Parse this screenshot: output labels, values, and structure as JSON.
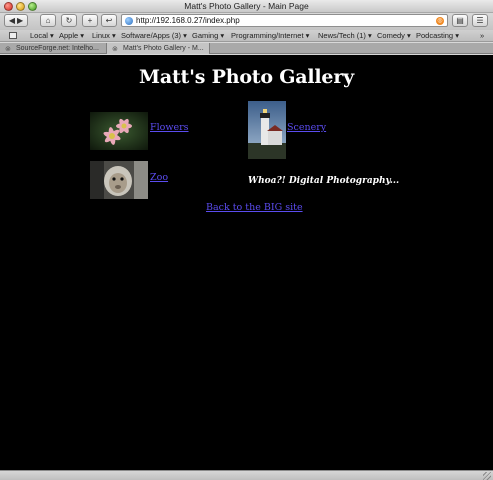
{
  "window": {
    "title": "Matt's Photo Gallery - Main Page"
  },
  "toolbar": {
    "back_icon": "back-arrow-icon",
    "forward_icon": "forward-arrow-icon",
    "home_icon": "home-icon",
    "reload_icon": "reload-icon",
    "add_bookmark_icon": "plus-icon",
    "snapback_icon": "snapback-icon",
    "url": "http://192.168.0.27/index.php",
    "print_icon": "print-icon",
    "menu_icon": "page-menu-icon"
  },
  "bookmarks": {
    "items": [
      "Local ▾",
      "Apple ▾",
      "Linux ▾",
      "Software/Apps (3) ▾",
      "Gaming ▾",
      "Programming/Internet ▾",
      "News/Tech (1) ▾",
      "Comedy ▾",
      "Podcasting ▾"
    ],
    "overflow": "»"
  },
  "tabs": [
    {
      "label": "SourceForge.net: Intelho...",
      "active": false
    },
    {
      "label": "Matt's Photo Gallery - M...",
      "active": true
    }
  ],
  "page": {
    "heading": "Matt's Photo Gallery",
    "galleries": [
      {
        "label": "Flowers"
      },
      {
        "label": "Scenery"
      },
      {
        "label": "Zoo"
      }
    ],
    "tagline": "Whoa?! Digital Photography...",
    "back_link": "Back to the BIG site"
  },
  "colors": {
    "page_background": "#000000",
    "link": "#5b4cf0",
    "heading": "#ffffff"
  }
}
